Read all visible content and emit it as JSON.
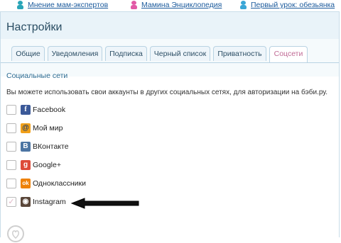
{
  "toplinks": [
    {
      "label": "Мнение мам-экспертов",
      "icon": "girl-figure-icon",
      "color": "#2aa5b8"
    },
    {
      "label": "Мамина Энциклопедия",
      "icon": "girl-figure-icon",
      "color": "#e25aa6"
    },
    {
      "label": "Первый урок: обезьянка",
      "icon": "monkey-figure-icon",
      "color": "#3aa6d6"
    }
  ],
  "page": {
    "title": "Настройки"
  },
  "tabs": [
    {
      "label": "Общие",
      "active": false
    },
    {
      "label": "Уведомления",
      "active": false
    },
    {
      "label": "Подписка",
      "active": false
    },
    {
      "label": "Черный список",
      "active": false
    },
    {
      "label": "Приватность",
      "active": false
    },
    {
      "label": "Соцсети",
      "active": true
    }
  ],
  "section": {
    "title": "Социальные сети",
    "description": "Вы можете использовать свои аккаунты в других социальных сетях, для авторизации на бэби.ру."
  },
  "networks": [
    {
      "label": "Facebook",
      "icon": "facebook-icon",
      "color": "#3b5998",
      "glyph": "f",
      "checked": false
    },
    {
      "label": "Мой мир",
      "icon": "moi-mir-icon",
      "color": "#f1a019",
      "glyph": "@",
      "checked": false
    },
    {
      "label": "ВКонтакте",
      "icon": "vkontakte-icon",
      "color": "#4c75a3",
      "glyph": "В",
      "checked": false
    },
    {
      "label": "Google+",
      "icon": "google-plus-icon",
      "color": "#dd4b39",
      "glyph": "g",
      "checked": false
    },
    {
      "label": "Одноклассники",
      "icon": "odnoklassniki-icon",
      "color": "#ee8208",
      "glyph": "ok",
      "checked": false
    },
    {
      "label": "Instagram",
      "icon": "instagram-icon",
      "color": "#5a4639",
      "glyph": "◉",
      "checked": true
    }
  ],
  "annotation": {
    "icon": "left-arrow-icon",
    "color": "#000000"
  },
  "footer": {
    "icon": "babyru-logo-icon",
    "color": "#cfcfcf"
  }
}
